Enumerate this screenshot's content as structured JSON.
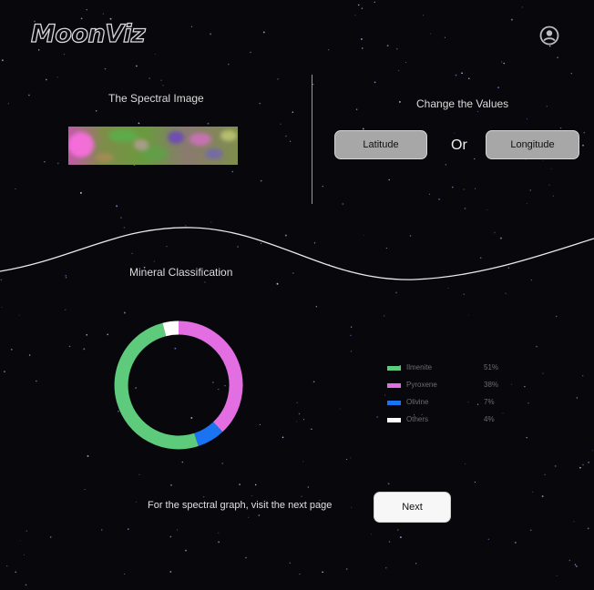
{
  "app": {
    "logo_text": "MoonViz",
    "profile_icon": "user-circle-icon"
  },
  "spectral": {
    "title": "The Spectral Image"
  },
  "controls": {
    "title": "Change the Values",
    "latitude_label": "Latitude",
    "or_text": "Or",
    "longitude_label": "Longitude"
  },
  "classification": {
    "title": "Mineral Classification",
    "minerals": [
      {
        "name": "Ilmenite",
        "percent": "51%",
        "value": 51,
        "color": "#5ecb7c"
      },
      {
        "name": "Pyroxene",
        "percent": "38%",
        "value": 38,
        "color": "#e26ee2"
      },
      {
        "name": "Olivine",
        "percent": "7%",
        "value": 7,
        "color": "#1a73f0"
      },
      {
        "name": "Others",
        "percent": "4%",
        "value": 4,
        "color": "#ffffff"
      }
    ]
  },
  "footer": {
    "text": "For the spectral graph, visit the next page",
    "next_label": "Next"
  }
}
